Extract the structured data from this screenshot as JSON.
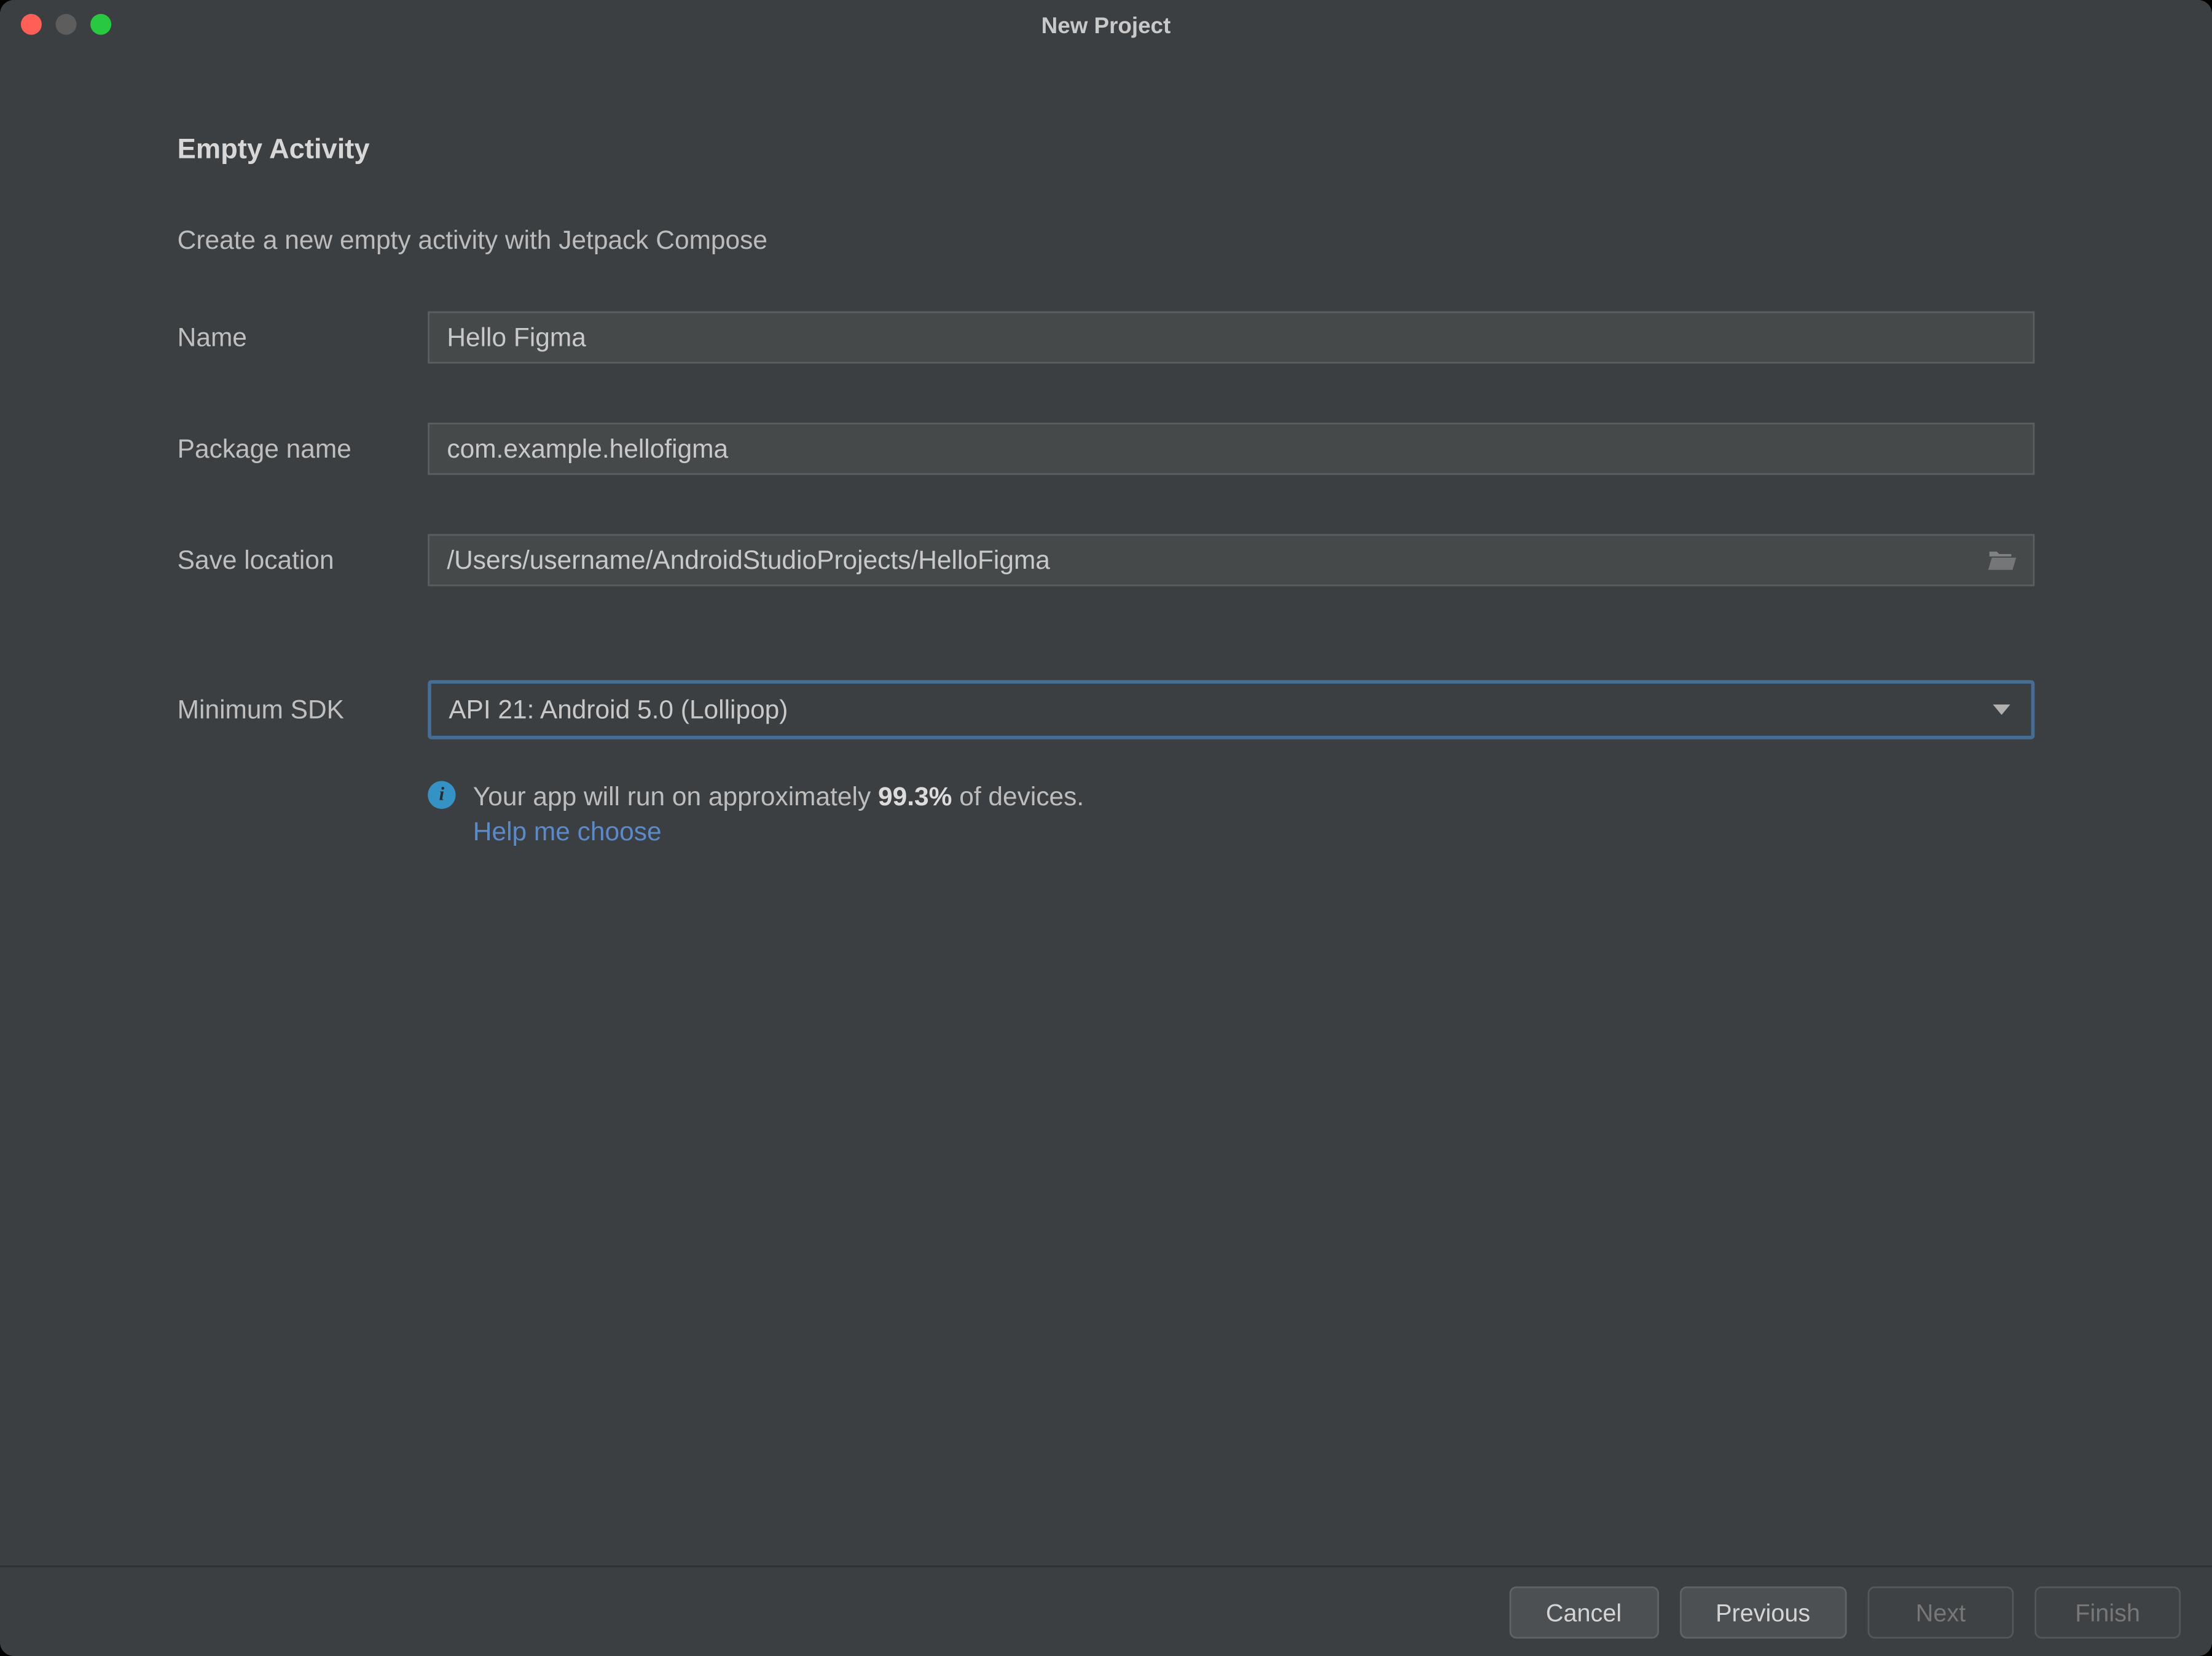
{
  "window": {
    "title": "New Project"
  },
  "page": {
    "heading": "Empty Activity",
    "subheading": "Create a new empty activity with Jetpack Compose"
  },
  "form": {
    "name_label": "Name",
    "name_value": "Hello Figma",
    "package_label": "Package name",
    "package_value": "com.example.hellofigma",
    "location_label": "Save location",
    "location_value": "/Users/username/AndroidStudioProjects/HelloFigma",
    "sdk_label": "Minimum SDK",
    "sdk_value": "API 21: Android 5.0 (Lollipop)"
  },
  "info": {
    "prefix": "Your app will run on approximately ",
    "percent": "99.3%",
    "suffix": " of devices.",
    "help_link": "Help me choose"
  },
  "footer": {
    "cancel": "Cancel",
    "previous": "Previous",
    "next": "Next",
    "finish": "Finish"
  },
  "colors": {
    "background": "#3C3F41",
    "input_bg": "#45494A",
    "focus_border": "#466D94",
    "link": "#598ACB",
    "info_icon": "#3592C4"
  }
}
